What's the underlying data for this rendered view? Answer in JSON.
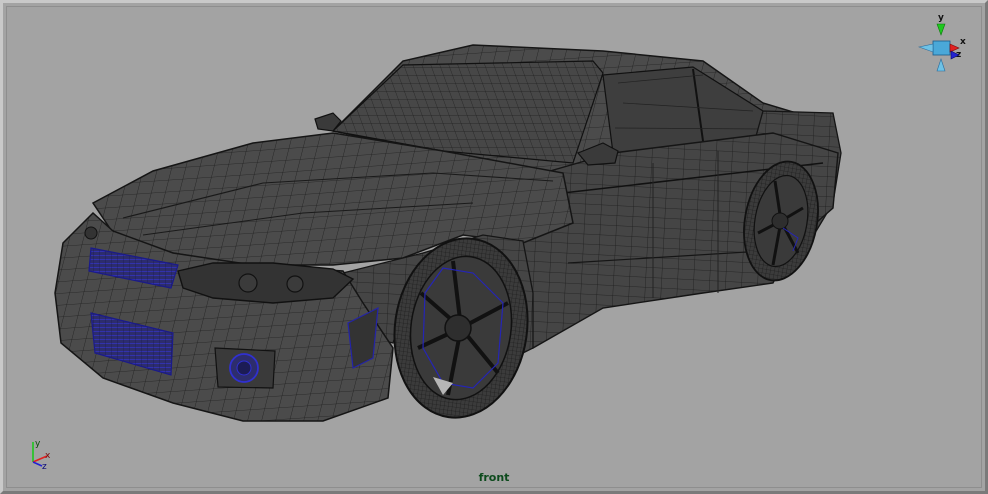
{
  "viewport": {
    "camera_label": "front",
    "background_color": "#a3a3a3",
    "model_color": "#4a4a4a",
    "wire_color": "#1c1c1c",
    "selection_color": "#2020c0"
  },
  "view_cube": {
    "up_label": "y",
    "right_label": "x",
    "depth_label": "z"
  },
  "axis_indicator": {
    "x": "x",
    "y": "y",
    "z": "z"
  }
}
